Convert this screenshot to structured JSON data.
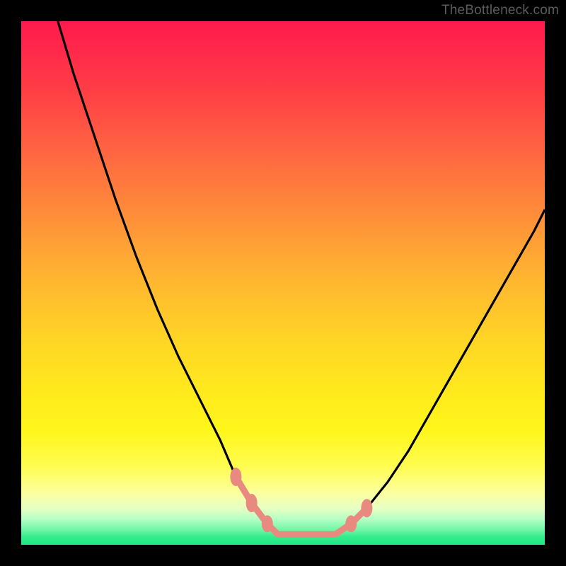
{
  "watermark": {
    "text": "TheBottleneck.com"
  },
  "chart_data": {
    "type": "line",
    "title": "",
    "xlabel": "",
    "ylabel": "",
    "xlim": [
      0,
      100
    ],
    "ylim": [
      0,
      100
    ],
    "grid": false,
    "legend": false,
    "background_gradient": {
      "orientation": "vertical",
      "stops": [
        {
          "pos": 0.0,
          "color": "#ff1a4d"
        },
        {
          "pos": 0.5,
          "color": "#ffc028"
        },
        {
          "pos": 0.8,
          "color": "#fff61a"
        },
        {
          "pos": 1.0,
          "color": "#1fe885"
        }
      ]
    },
    "series": [
      {
        "name": "left-curve",
        "color": "#000000",
        "x": [
          7,
          10,
          14,
          18,
          22,
          26,
          30,
          34,
          38,
          41,
          44,
          47,
          49
        ],
        "values": [
          100,
          90,
          78,
          66,
          55,
          45,
          36,
          28,
          20,
          13,
          8,
          4,
          2
        ]
      },
      {
        "name": "right-curve",
        "color": "#000000",
        "x": [
          60,
          63,
          66,
          70,
          74,
          78,
          82,
          86,
          90,
          94,
          98,
          100
        ],
        "values": [
          2,
          4,
          7,
          12,
          18,
          25,
          32,
          39,
          46,
          53,
          60,
          64
        ]
      },
      {
        "name": "bottom-flat",
        "color": "#e98a80",
        "x": [
          41,
          44,
          47,
          49,
          51,
          54,
          57,
          60,
          63,
          66
        ],
        "values": [
          13,
          8,
          4,
          2,
          2,
          2,
          2,
          2,
          4,
          7
        ]
      }
    ],
    "markers": [
      {
        "x": 41,
        "y": 13,
        "color": "#e98a80"
      },
      {
        "x": 44,
        "y": 8,
        "color": "#e98a80"
      },
      {
        "x": 47,
        "y": 4,
        "color": "#e98a80"
      },
      {
        "x": 63,
        "y": 4,
        "color": "#e98a80"
      },
      {
        "x": 66,
        "y": 7,
        "color": "#e98a80"
      }
    ]
  }
}
